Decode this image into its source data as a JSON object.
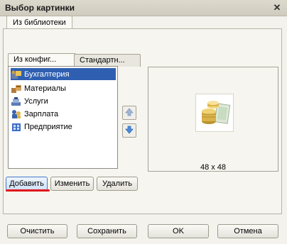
{
  "window": {
    "title": "Выбор картинки"
  },
  "tabs": {
    "top": "Из библиотеки",
    "sub_active": "Из конфиг...",
    "sub_inactive": "Стандартн..."
  },
  "list": {
    "items": [
      {
        "label": "Бухгалтерия",
        "icon": "accounting-icon",
        "selected": true
      },
      {
        "label": "Материалы",
        "icon": "materials-icon",
        "selected": false
      },
      {
        "label": "Услуги",
        "icon": "services-icon",
        "selected": false
      },
      {
        "label": "Зарплата",
        "icon": "salary-icon",
        "selected": false
      },
      {
        "label": "Предприятие",
        "icon": "enterprise-icon",
        "selected": false
      }
    ]
  },
  "preview": {
    "size_label": "48 x 48",
    "image": "coins-money-icon"
  },
  "buttons": {
    "add": "Добавить",
    "edit": "Изменить",
    "delete": "Удалить",
    "clear": "Очистить",
    "save": "Сохранить",
    "ok": "OK",
    "cancel": "Отмена"
  },
  "colors": {
    "selection": "#2f5fb0",
    "annotation": "#e0141b"
  }
}
